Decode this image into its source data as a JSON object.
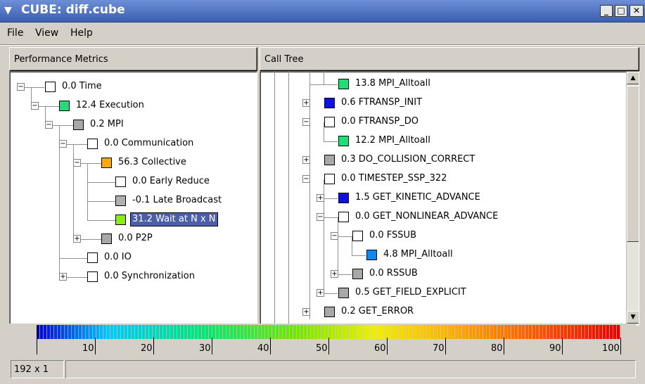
{
  "window": {
    "title": "CUBE: diff.cube",
    "menu_icon": "down-arrow-icon",
    "buttons": {
      "minimize": "_",
      "maximize": "□",
      "close": "✕"
    }
  },
  "menubar": {
    "items": [
      {
        "label": "File",
        "accel": "F"
      },
      {
        "label": "View",
        "accel": "V"
      },
      {
        "label": "Help",
        "accel": "H"
      }
    ]
  },
  "metrics_panel": {
    "header": "Performance Metrics",
    "nodes": [
      {
        "value": "0.0",
        "name": "Time",
        "color": "#ffffff",
        "expander": "−"
      },
      {
        "value": "12.4",
        "name": "Execution",
        "color": "#22dd77",
        "expander": "−"
      },
      {
        "value": "0.2",
        "name": "MPI",
        "color": "#a8a8a8",
        "expander": "−"
      },
      {
        "value": "0.0",
        "name": "Communication",
        "color": "#ffffff",
        "expander": "−"
      },
      {
        "value": "56.3",
        "name": "Collective",
        "color": "#ffaa00",
        "expander": "−"
      },
      {
        "value": "0.0",
        "name": "Early Reduce",
        "color": "#ffffff",
        "expander": ""
      },
      {
        "value": "-0.1",
        "name": "Late Broadcast",
        "color": "#b0b0b0",
        "expander": ""
      },
      {
        "value": "31.2",
        "name": "Wait at N x N",
        "color": "#88ee11",
        "expander": "",
        "selected": true
      },
      {
        "value": "0.0",
        "name": "P2P",
        "color": "#a8a8a8",
        "expander": "+"
      },
      {
        "value": "0.0",
        "name": "IO",
        "color": "#ffffff",
        "expander": ""
      },
      {
        "value": "0.0",
        "name": "Synchronization",
        "color": "#ffffff",
        "expander": "+"
      }
    ]
  },
  "calltree_panel": {
    "header": "Call Tree",
    "nodes": [
      {
        "value": "13.8",
        "name": "MPI_Alltoall",
        "color": "#22dd77",
        "expander": ""
      },
      {
        "value": "0.6",
        "name": "FTRANSP_INIT",
        "color": "#1111dd",
        "expander": "+"
      },
      {
        "value": "0.0",
        "name": "FTRANSP_DO",
        "color": "#ffffff",
        "expander": "−"
      },
      {
        "value": "12.2",
        "name": "MPI_Alltoall",
        "color": "#22dd77",
        "expander": ""
      },
      {
        "value": "0.3",
        "name": "DO_COLLISION_CORRECT",
        "color": "#a8a8a8",
        "expander": "+"
      },
      {
        "value": "0.0",
        "name": "TIMESTEP_SSP_322",
        "color": "#ffffff",
        "expander": "−"
      },
      {
        "value": "1.5",
        "name": "GET_KINETIC_ADVANCE",
        "color": "#1111dd",
        "expander": "+"
      },
      {
        "value": "0.0",
        "name": "GET_NONLINEAR_ADVANCE",
        "color": "#ffffff",
        "expander": "−"
      },
      {
        "value": "0.0",
        "name": "FSSUB",
        "color": "#ffffff",
        "expander": "−"
      },
      {
        "value": "4.8",
        "name": "MPI_Alltoall",
        "color": "#1188ee",
        "expander": ""
      },
      {
        "value": "0.0",
        "name": "RSSUB",
        "color": "#a8a8a8",
        "expander": "+"
      },
      {
        "value": "0.5",
        "name": "GET_FIELD_EXPLICIT",
        "color": "#a8a8a8",
        "expander": "+"
      },
      {
        "value": "0.2",
        "name": "GET_ERROR",
        "color": "#a8a8a8",
        "expander": "+"
      }
    ]
  },
  "color_scale": {
    "tick_labels": [
      "10",
      "20",
      "30",
      "40",
      "50",
      "60",
      "70",
      "80",
      "90",
      "100"
    ]
  },
  "status": {
    "dimensions": "192 x 1"
  }
}
